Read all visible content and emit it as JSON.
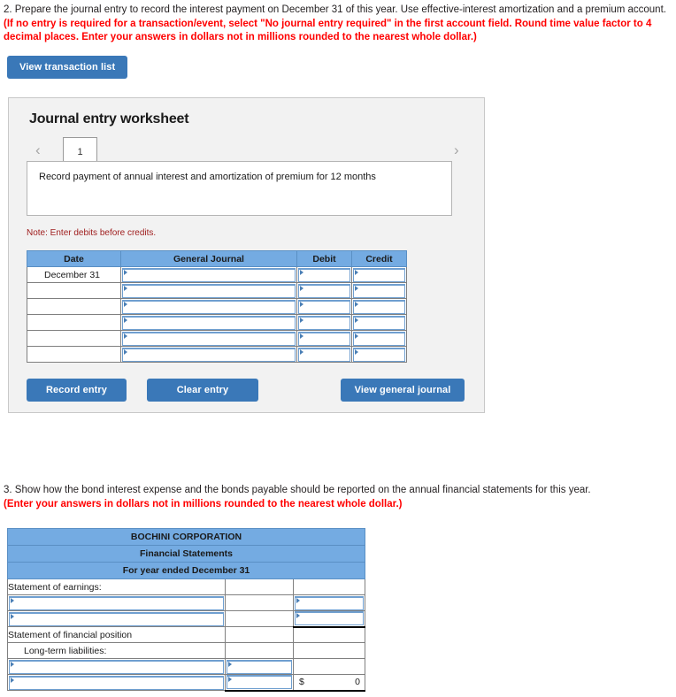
{
  "question2": {
    "number": "2.",
    "text_plain": "Prepare the journal entry to record the interest payment on December 31 of this year. Use effective-interest amortization and a premium account.",
    "text_red": "(If no entry is required for a transaction/event, select \"No journal entry required\" in the first account field. Round time value factor to 4 decimal places. Enter your answers in dollars not in millions rounded to the nearest whole dollar.)"
  },
  "question3": {
    "number": "3.",
    "text_plain": "Show how the bond interest expense and the bonds payable should be reported on the annual financial statements for this year.",
    "text_red": "(Enter your answers in dollars not in millions rounded to the nearest whole dollar.)"
  },
  "toolbar": {
    "view_transaction_list": "View transaction list"
  },
  "worksheet": {
    "title": "Journal entry worksheet",
    "pager": {
      "prev_glyph": "‹",
      "next_glyph": "›",
      "current_page": "1"
    },
    "description": "Record payment of annual interest and amortization of premium for 12 months",
    "note": "Note: Enter debits before credits.",
    "table": {
      "columns": [
        "Date",
        "General Journal",
        "Debit",
        "Credit"
      ],
      "rows": [
        {
          "date": "December 31",
          "general_journal": "",
          "debit": "",
          "credit": ""
        },
        {
          "date": "",
          "general_journal": "",
          "debit": "",
          "credit": ""
        },
        {
          "date": "",
          "general_journal": "",
          "debit": "",
          "credit": ""
        },
        {
          "date": "",
          "general_journal": "",
          "debit": "",
          "credit": ""
        },
        {
          "date": "",
          "general_journal": "",
          "debit": "",
          "credit": ""
        },
        {
          "date": "",
          "general_journal": "",
          "debit": "",
          "credit": ""
        }
      ]
    },
    "actions": {
      "record_entry": "Record entry",
      "clear_entry": "Clear entry",
      "view_general_journal": "View general journal"
    }
  },
  "financial_statements": {
    "header_lines": [
      "BOCHINI CORPORATION",
      "Financial Statements",
      "For year ended December 31"
    ],
    "rows": [
      {
        "label": "Statement of earnings:",
        "indent": false,
        "kind": "label",
        "c2": "",
        "c3": ""
      },
      {
        "label": "",
        "indent": false,
        "kind": "input-c1-c3",
        "c2": "",
        "c3": ""
      },
      {
        "label": "",
        "indent": false,
        "kind": "input-c1-c3",
        "c2": "",
        "c3": ""
      },
      {
        "label": "Statement of financial position",
        "indent": false,
        "kind": "label",
        "c2": "",
        "c3": ""
      },
      {
        "label": "Long-term liabilities:",
        "indent": true,
        "kind": "label",
        "c2": "",
        "c3": ""
      },
      {
        "label": "",
        "indent": false,
        "kind": "input-c1-c2",
        "c2": "",
        "c3": ""
      },
      {
        "label": "",
        "indent": false,
        "kind": "input-c1-c2-total",
        "c2": "",
        "c3_currency": "$",
        "c3_value": "0"
      }
    ]
  },
  "colors": {
    "button_blue": "#3a78b8",
    "header_blue": "#74abe2",
    "field_border": "#6f9fd0",
    "red_text": "#ff0000",
    "note_red": "#a02020",
    "panel_bg": "#f2f2f2"
  }
}
